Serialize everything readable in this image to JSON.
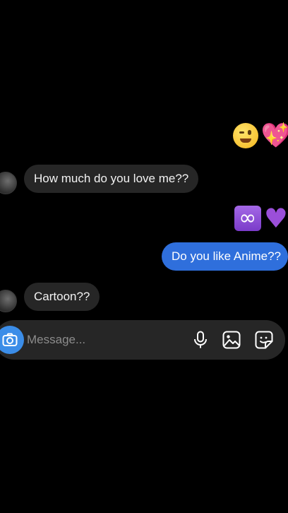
{
  "messages": [
    {
      "sender": "other",
      "text": "How much do you love me??"
    },
    {
      "sender": "me",
      "text": "Do you like Anime??"
    },
    {
      "sender": "other",
      "text": "Cartoon??"
    }
  ],
  "emoji_rows": [
    {
      "sender": "me",
      "emojis": [
        "winking-face",
        "sparkling-heart"
      ]
    },
    {
      "sender": "me",
      "emojis": [
        "infinity",
        "purple-heart"
      ]
    }
  ],
  "composer": {
    "placeholder": "Message...",
    "icons": [
      "camera-icon",
      "microphone-icon",
      "gallery-icon",
      "sticker-icon"
    ]
  },
  "colors": {
    "background": "#000000",
    "incoming_bubble": "#262626",
    "outgoing_bubble": "#2f6fdc",
    "camera_button": "#3b8de8"
  }
}
